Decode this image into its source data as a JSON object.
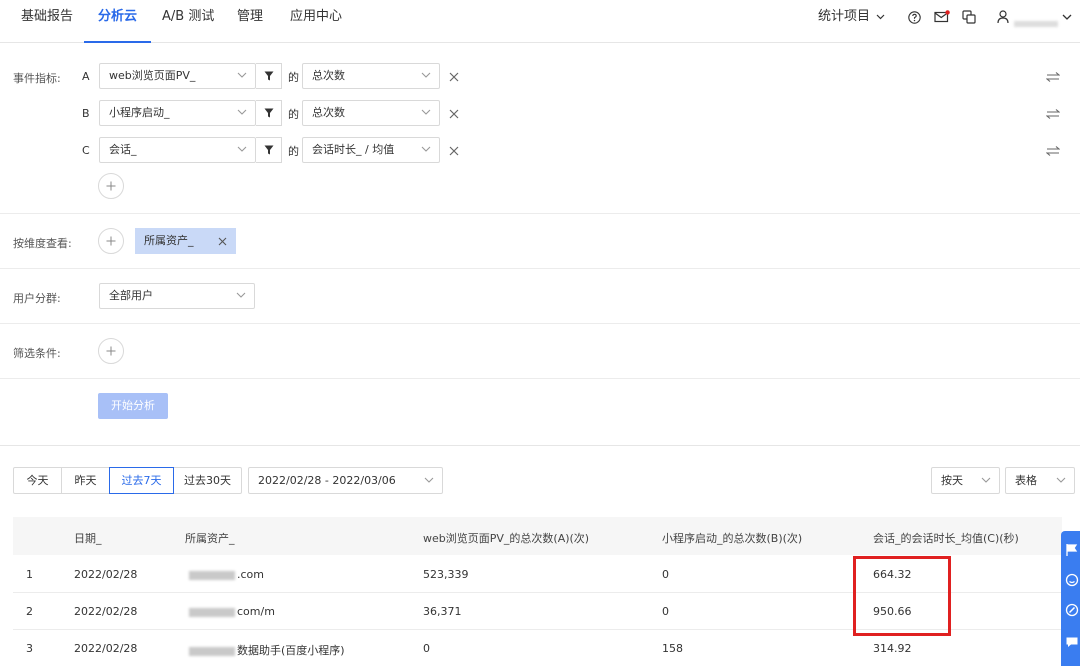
{
  "nav": {
    "tabs": [
      "基础报告",
      "分析云",
      "A/B 测试",
      "管理",
      "应用中心"
    ],
    "active_tab": "分析云",
    "project_menu": "统计项目",
    "accent": "#2a6ae9"
  },
  "query": {
    "event_label": "事件指标:",
    "events": [
      {
        "letter": "A",
        "event": "web浏览页面PV_",
        "connector": "的",
        "metric": "总次数"
      },
      {
        "letter": "B",
        "event": "小程序启动_",
        "connector": "的",
        "metric": "总次数"
      },
      {
        "letter": "C",
        "event": "会话_",
        "connector": "的",
        "metric": "会话时长_ / 均值"
      }
    ],
    "dimension_label": "按维度查看:",
    "dimension_chip": "所属资产_",
    "segment_label": "用户分群:",
    "segment_value": "全部用户",
    "filter_label": "筛选条件:",
    "start_button": "开始分析"
  },
  "results": {
    "date_tabs": [
      "今天",
      "昨天",
      "过去7天",
      "过去30天"
    ],
    "active_date_tab": "过去7天",
    "date_range": "2022/02/28 - 2022/03/06",
    "granularity": "按天",
    "view_mode": "表格",
    "columns": [
      "",
      "日期_",
      "所属资产_",
      "web浏览页面PV_的总次数(A)(次)",
      "小程序启动_的总次数(B)(次)",
      "会话_的会话时长_均值(C)(秒)"
    ],
    "rows": [
      {
        "index": "1",
        "date": "2022/02/28",
        "asset": ".com",
        "a": "523,339",
        "b": "0",
        "c": "664.32"
      },
      {
        "index": "2",
        "date": "2022/02/28",
        "asset": "com/m",
        "a": "36,371",
        "b": "0",
        "c": "950.66"
      },
      {
        "index": "3",
        "date": "2022/02/28",
        "asset": "数据助手(百度小程序)",
        "a": "0",
        "b": "158",
        "c": "314.92"
      }
    ],
    "highlight_color": "#e02020"
  }
}
